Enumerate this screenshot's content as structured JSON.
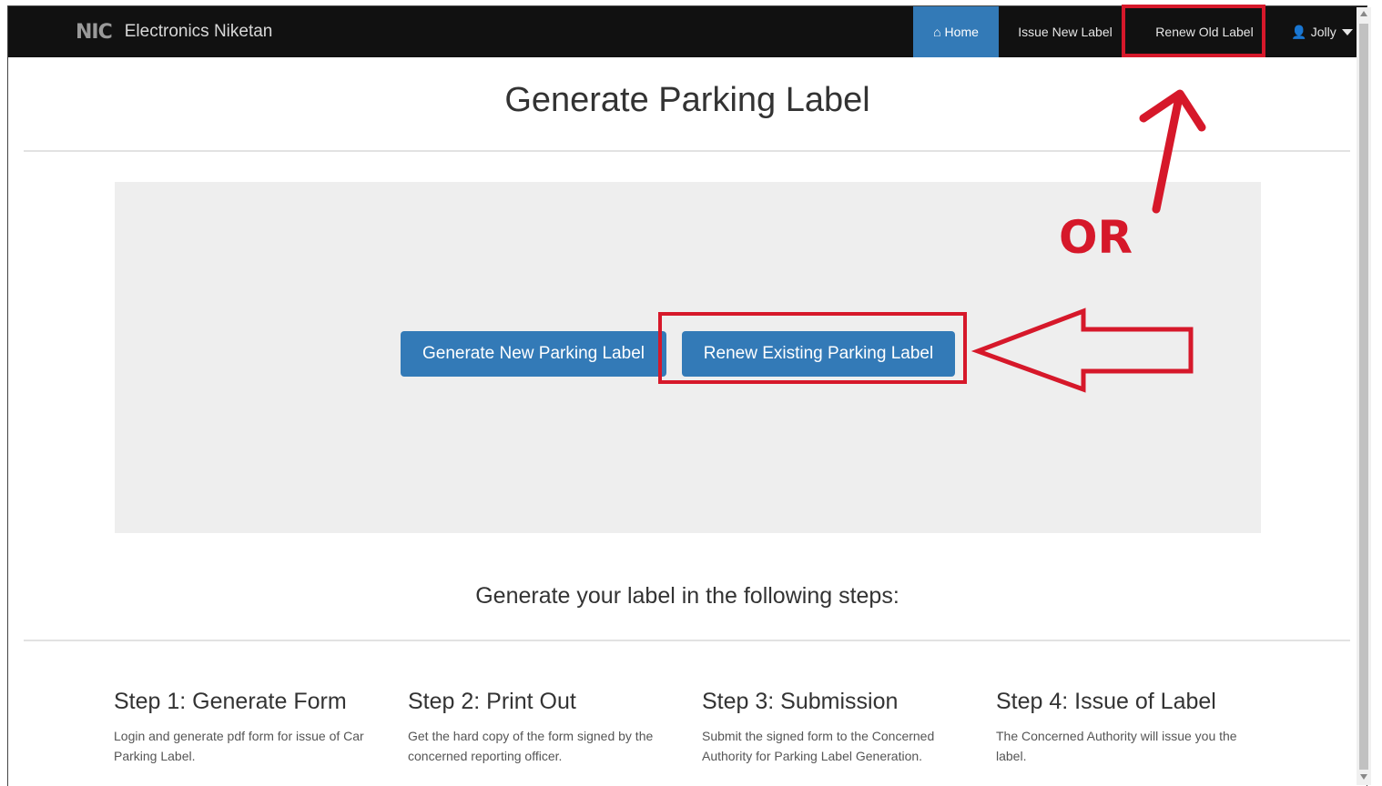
{
  "navbar": {
    "logo": "NIC",
    "brand": "Electronics Niketan",
    "home_label": "Home",
    "issue_label": "Issue New Label",
    "renew_label": "Renew Old Label",
    "user_label": "Jolly"
  },
  "page_title": "Generate Parking Label",
  "actions": {
    "generate_new": "Generate New Parking Label",
    "renew_existing": "Renew Existing Parking Label"
  },
  "annotation": {
    "or_text": "OR",
    "color": "#d6182a"
  },
  "subtitle": "Generate your label in the following steps:",
  "steps": [
    {
      "title": "Step 1: Generate Form",
      "desc": "Login and generate pdf form for issue of Car Parking Label."
    },
    {
      "title": "Step 2: Print Out",
      "desc": "Get the hard copy of the form signed by the concerned reporting officer."
    },
    {
      "title": "Step 3: Submission",
      "desc": "Submit the signed form to the Concerned Authority for Parking Label Generation."
    },
    {
      "title": "Step 4: Issue of Label",
      "desc": "The Concerned Authority will issue you the label."
    }
  ],
  "colors": {
    "navbar": "#111111",
    "primary": "#337ab7",
    "jumbotron": "#eeeeee"
  }
}
